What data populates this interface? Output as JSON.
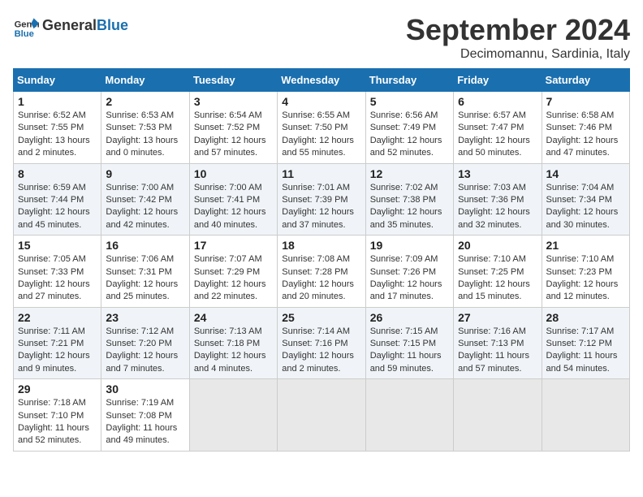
{
  "logo": {
    "text_general": "General",
    "text_blue": "Blue"
  },
  "title": "September 2024",
  "location": "Decimomannu, Sardinia, Italy",
  "days_of_week": [
    "Sunday",
    "Monday",
    "Tuesday",
    "Wednesday",
    "Thursday",
    "Friday",
    "Saturday"
  ],
  "weeks": [
    [
      {
        "day": 1,
        "sunrise": "6:52 AM",
        "sunset": "7:55 PM",
        "daylight": "13 hours and 2 minutes."
      },
      {
        "day": 2,
        "sunrise": "6:53 AM",
        "sunset": "7:53 PM",
        "daylight": "13 hours and 0 minutes."
      },
      {
        "day": 3,
        "sunrise": "6:54 AM",
        "sunset": "7:52 PM",
        "daylight": "12 hours and 57 minutes."
      },
      {
        "day": 4,
        "sunrise": "6:55 AM",
        "sunset": "7:50 PM",
        "daylight": "12 hours and 55 minutes."
      },
      {
        "day": 5,
        "sunrise": "6:56 AM",
        "sunset": "7:49 PM",
        "daylight": "12 hours and 52 minutes."
      },
      {
        "day": 6,
        "sunrise": "6:57 AM",
        "sunset": "7:47 PM",
        "daylight": "12 hours and 50 minutes."
      },
      {
        "day": 7,
        "sunrise": "6:58 AM",
        "sunset": "7:46 PM",
        "daylight": "12 hours and 47 minutes."
      }
    ],
    [
      {
        "day": 8,
        "sunrise": "6:59 AM",
        "sunset": "7:44 PM",
        "daylight": "12 hours and 45 minutes."
      },
      {
        "day": 9,
        "sunrise": "7:00 AM",
        "sunset": "7:42 PM",
        "daylight": "12 hours and 42 minutes."
      },
      {
        "day": 10,
        "sunrise": "7:00 AM",
        "sunset": "7:41 PM",
        "daylight": "12 hours and 40 minutes."
      },
      {
        "day": 11,
        "sunrise": "7:01 AM",
        "sunset": "7:39 PM",
        "daylight": "12 hours and 37 minutes."
      },
      {
        "day": 12,
        "sunrise": "7:02 AM",
        "sunset": "7:38 PM",
        "daylight": "12 hours and 35 minutes."
      },
      {
        "day": 13,
        "sunrise": "7:03 AM",
        "sunset": "7:36 PM",
        "daylight": "12 hours and 32 minutes."
      },
      {
        "day": 14,
        "sunrise": "7:04 AM",
        "sunset": "7:34 PM",
        "daylight": "12 hours and 30 minutes."
      }
    ],
    [
      {
        "day": 15,
        "sunrise": "7:05 AM",
        "sunset": "7:33 PM",
        "daylight": "12 hours and 27 minutes."
      },
      {
        "day": 16,
        "sunrise": "7:06 AM",
        "sunset": "7:31 PM",
        "daylight": "12 hours and 25 minutes."
      },
      {
        "day": 17,
        "sunrise": "7:07 AM",
        "sunset": "7:29 PM",
        "daylight": "12 hours and 22 minutes."
      },
      {
        "day": 18,
        "sunrise": "7:08 AM",
        "sunset": "7:28 PM",
        "daylight": "12 hours and 20 minutes."
      },
      {
        "day": 19,
        "sunrise": "7:09 AM",
        "sunset": "7:26 PM",
        "daylight": "12 hours and 17 minutes."
      },
      {
        "day": 20,
        "sunrise": "7:10 AM",
        "sunset": "7:25 PM",
        "daylight": "12 hours and 15 minutes."
      },
      {
        "day": 21,
        "sunrise": "7:10 AM",
        "sunset": "7:23 PM",
        "daylight": "12 hours and 12 minutes."
      }
    ],
    [
      {
        "day": 22,
        "sunrise": "7:11 AM",
        "sunset": "7:21 PM",
        "daylight": "12 hours and 9 minutes."
      },
      {
        "day": 23,
        "sunrise": "7:12 AM",
        "sunset": "7:20 PM",
        "daylight": "12 hours and 7 minutes."
      },
      {
        "day": 24,
        "sunrise": "7:13 AM",
        "sunset": "7:18 PM",
        "daylight": "12 hours and 4 minutes."
      },
      {
        "day": 25,
        "sunrise": "7:14 AM",
        "sunset": "7:16 PM",
        "daylight": "12 hours and 2 minutes."
      },
      {
        "day": 26,
        "sunrise": "7:15 AM",
        "sunset": "7:15 PM",
        "daylight": "11 hours and 59 minutes."
      },
      {
        "day": 27,
        "sunrise": "7:16 AM",
        "sunset": "7:13 PM",
        "daylight": "11 hours and 57 minutes."
      },
      {
        "day": 28,
        "sunrise": "7:17 AM",
        "sunset": "7:12 PM",
        "daylight": "11 hours and 54 minutes."
      }
    ],
    [
      {
        "day": 29,
        "sunrise": "7:18 AM",
        "sunset": "7:10 PM",
        "daylight": "11 hours and 52 minutes."
      },
      {
        "day": 30,
        "sunrise": "7:19 AM",
        "sunset": "7:08 PM",
        "daylight": "11 hours and 49 minutes."
      },
      null,
      null,
      null,
      null,
      null
    ]
  ]
}
